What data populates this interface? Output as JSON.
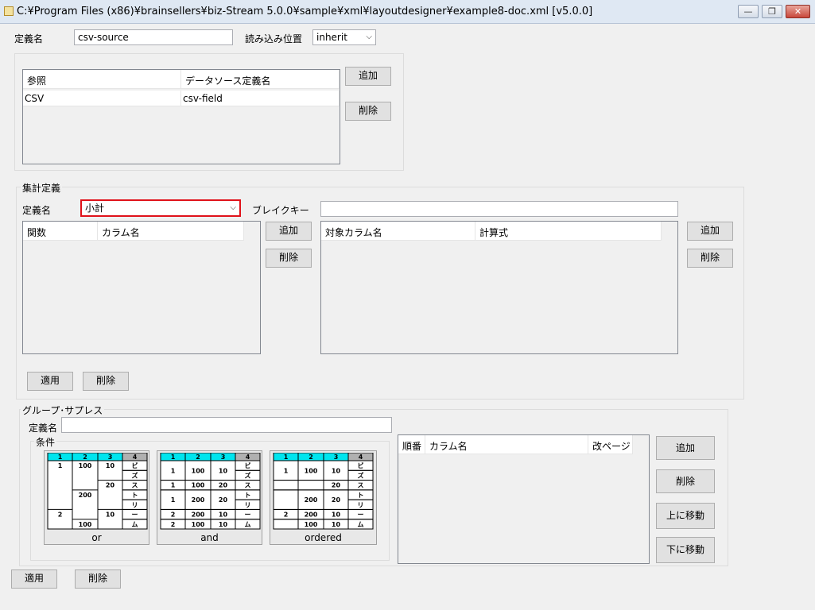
{
  "window": {
    "title": "C:¥Program Files (x86)¥brainsellers¥biz-Stream 5.0.0¥sample¥xml¥layoutdesigner¥example8-doc.xml [v5.0.0]",
    "minimize_glyph": "—",
    "restore_glyph": "❐",
    "close_glyph": "✕"
  },
  "top": {
    "name_label": "定義名",
    "name_value": "csv-source",
    "load_label": "読み込み位置",
    "load_value": "inherit"
  },
  "reference": {
    "headers": [
      "参照",
      "データソース定義名"
    ],
    "rows": [
      [
        "CSV",
        "csv-field"
      ]
    ],
    "add": "追加",
    "delete": "削除"
  },
  "aggregate": {
    "legend": "集計定義",
    "name_label": "定義名",
    "name_value": "小計",
    "break_label": "ブレイクキー",
    "break_value": "",
    "left_headers": [
      "関数",
      "カラム名"
    ],
    "right_headers": [
      "対象カラム名",
      "計算式"
    ],
    "add": "追加",
    "delete": "削除",
    "apply": "適用",
    "apply_delete": "削除"
  },
  "group": {
    "legend": "グループ･サプレス",
    "name_label": "定義名",
    "name_value": "",
    "cond_legend": "条件",
    "options": [
      {
        "caption": "or",
        "cols": [
          [
            "1",
            "",
            "",
            "",
            "2",
            ""
          ],
          [
            "100",
            "",
            "200",
            "",
            "",
            "100"
          ],
          [
            "10",
            "",
            "20",
            "",
            "10",
            ""
          ],
          [
            "ビ",
            "ズ",
            "ス",
            "ト",
            "リ",
            "ー",
            "ム"
          ]
        ]
      },
      {
        "caption": "and",
        "rows": [
          [
            "1",
            "100",
            "10",
            "ビ"
          ],
          [
            "1",
            "100",
            "20",
            "ス"
          ],
          [
            "1",
            "200",
            "20",
            "ト"
          ],
          [
            "2",
            "200",
            "10",
            "ー"
          ],
          [
            "2",
            "100",
            "10",
            "ム"
          ]
        ]
      },
      {
        "caption": "ordered",
        "rows": [
          [
            "1",
            "100",
            "10",
            "ビ"
          ],
          [
            "",
            "",
            "20",
            "ス"
          ],
          [
            "",
            "200",
            "20",
            "ト"
          ],
          [
            "2",
            "200",
            "10",
            "ー"
          ],
          [
            "",
            "100",
            "10",
            "ム"
          ]
        ]
      }
    ],
    "header_cells": [
      "1",
      "2",
      "3",
      "4"
    ],
    "extra_chars": [
      "ズ",
      "リ"
    ],
    "list_headers": [
      "順番",
      "カラム名",
      "改ページ"
    ],
    "add": "追加",
    "delete": "削除",
    "move_up": "上に移動",
    "move_down": "下に移動"
  },
  "bottom": {
    "apply": "適用",
    "delete": "削除"
  },
  "colors": {
    "header_cyan": "#00e5ee",
    "header_gray": "#b0b0b0",
    "highlight_red": "#e0121a"
  }
}
